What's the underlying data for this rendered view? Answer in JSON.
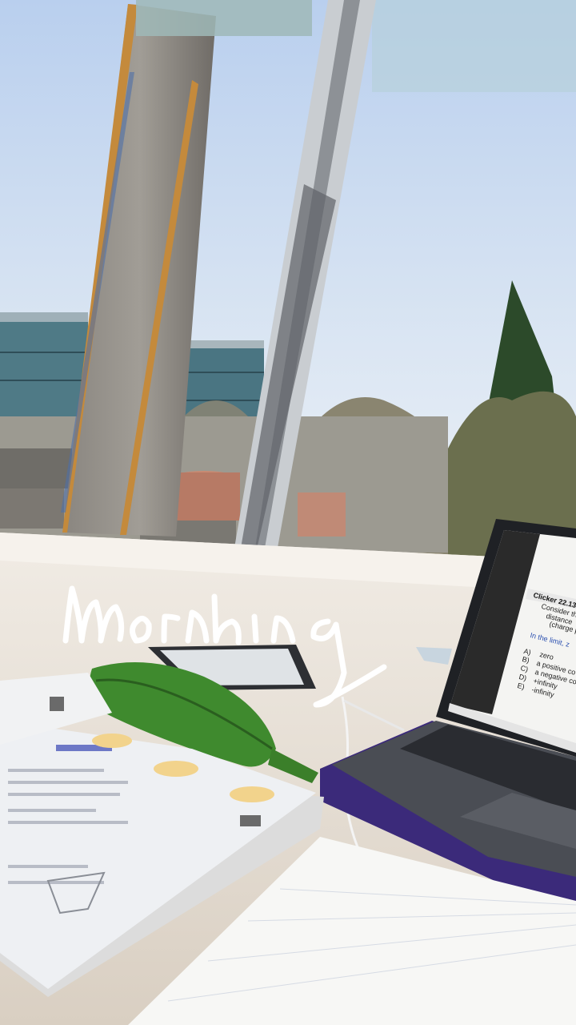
{
  "caption": {
    "text": "morning"
  },
  "laptop_screen": {
    "heading": "Clicker 22.13",
    "lines": [
      "Consider the",
      "distance",
      "(charge p"
    ],
    "prompt": "In the limit, z",
    "answers": [
      {
        "key": "A)",
        "text": "zero"
      },
      {
        "key": "B)",
        "text": "a positive co"
      },
      {
        "key": "C)",
        "text": "a negative co"
      },
      {
        "key": "D)",
        "text": "+infinity"
      },
      {
        "key": "E)",
        "text": "-infinity"
      }
    ]
  },
  "colors": {
    "sky_top": "#c4d6ef",
    "sky_bottom": "#e7eef6",
    "desk": "#e8e2da",
    "laptop_body": "#3a3d44",
    "laptop_sleeve": "#3b2a7a",
    "pencil_case": "#3f8a2e",
    "caption": "#ffffff"
  }
}
